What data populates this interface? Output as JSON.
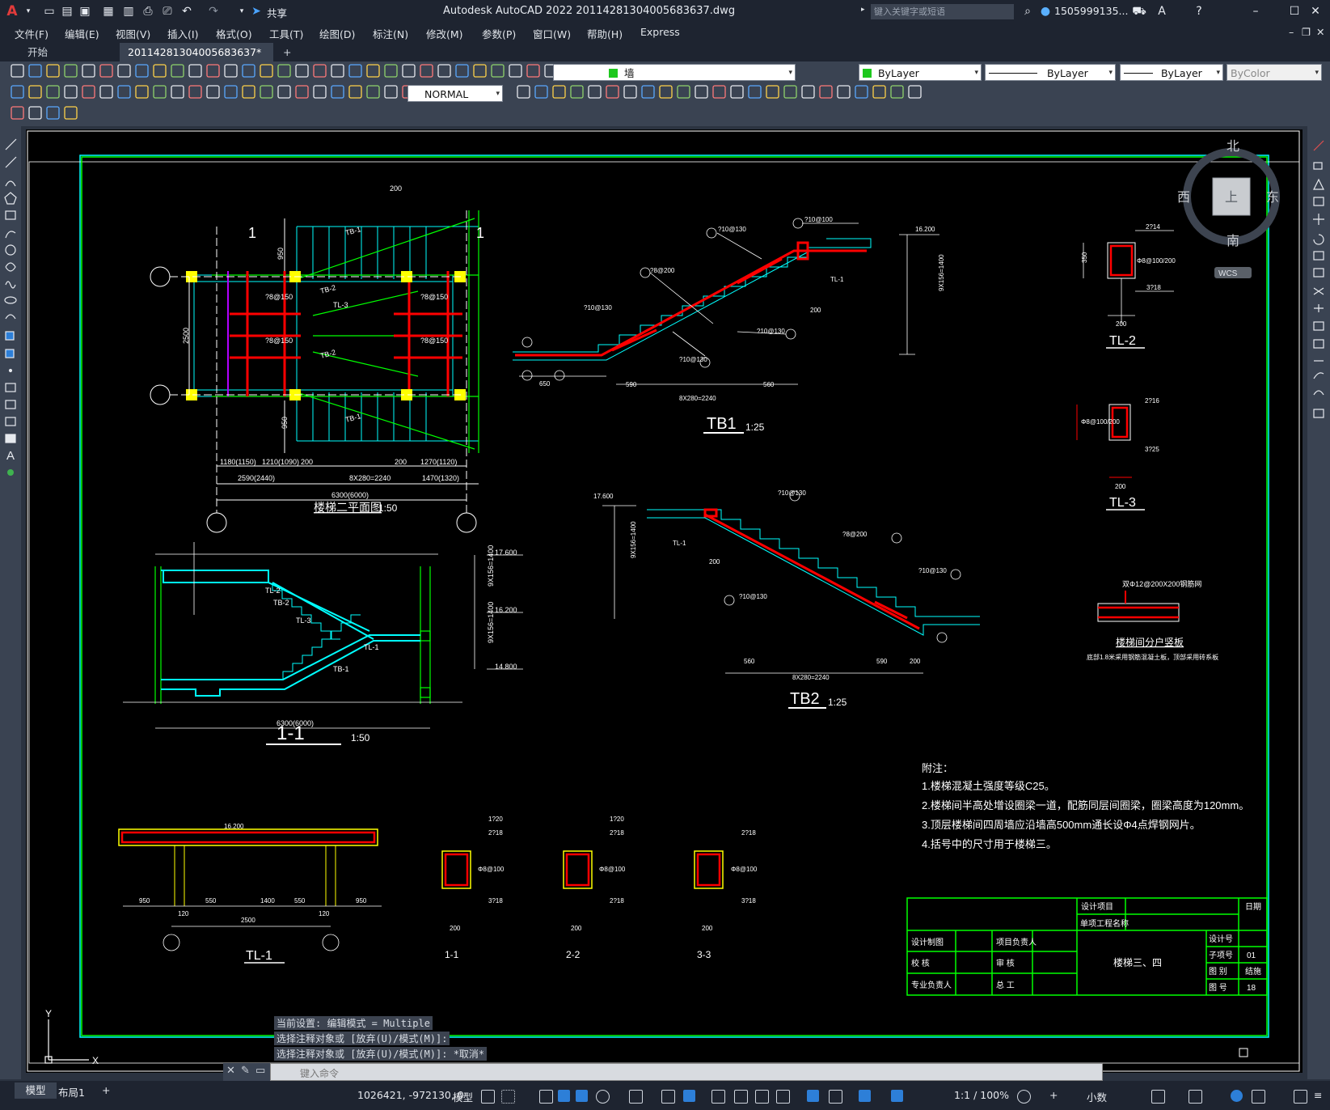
{
  "app": {
    "title": "Autodesk AutoCAD 2022    20114281304005683637.dwg",
    "search_placeholder": "键入关键字或短语",
    "user": "1505999135...",
    "share_label": "共享"
  },
  "menu": [
    "文件(F)",
    "编辑(E)",
    "视图(V)",
    "插入(I)",
    "格式(O)",
    "工具(T)",
    "绘图(D)",
    "标注(N)",
    "修改(M)",
    "参数(P)",
    "窗口(W)",
    "帮助(H)",
    "Express"
  ],
  "tabs": {
    "start": "开始",
    "active": "20114281304005683637*",
    "add": "+"
  },
  "properties": {
    "layer": "墙",
    "color": "ByLayer",
    "linetype": "ByLayer",
    "lineweight": "ByLayer",
    "plotstyle": "ByColor",
    "textstyle": "NORMAL"
  },
  "viewcube": {
    "north": "北",
    "south": "南",
    "east": "东",
    "west": "西",
    "top": "上",
    "wcs": "WCS"
  },
  "drawing": {
    "plan_title": "楼梯二平面图",
    "plan_scale": "1:50",
    "section_title": "1-1",
    "section_scale": "1:50",
    "tb1_title": "TB1",
    "tb1_scale": "1:25",
    "tb2_title": "TB2",
    "tb2_scale": "1:25",
    "tl1_title": "TL-1",
    "tl2_title": "TL-2",
    "tl3_title": "TL-3",
    "sec11": "1-1",
    "sec22": "2-2",
    "sec33": "3-3",
    "partition_title": "楼梯间分户竖板",
    "partition_note": "底部1.8米采用钢筋混凝土板，顶部采用砖系板",
    "partition_rebar": "双Φ12@200X200钢筋网",
    "notes_head": "附注：",
    "notes": [
      "1.楼梯混凝土强度等级C25。",
      "2.楼梯间半高处增设圈梁一道，配筋同层间圈梁，圈梁高度为120mm。",
      "3.顶层楼梯间四周墙应沿墙高500mm通长设Φ4点焊钢网片。",
      "4.括号中的尺寸用于楼梯三。"
    ],
    "dims": {
      "d200": "200",
      "d950": "950",
      "d2500": "2500",
      "d1180": "1180(1150)",
      "d1210": "1210(1090)",
      "d2590": "2590(2440)",
      "d8x280": "8X280=2240",
      "d1270": "1270(1120)",
      "d1470": "1470(1320)",
      "d6300": "6300(6000)",
      "d650": "650",
      "d590": "590",
      "d560": "560",
      "d16200": "16.200",
      "d17600": "17.600",
      "d14800": "14.800",
      "d9x156": "9X156=1400",
      "d1400": "1400",
      "d550": "550",
      "d120": "120",
      "d350": "350"
    },
    "labels": {
      "tb1": "TB-1",
      "tb2": "TB-2",
      "tl1": "TL-1",
      "tl2": "TL-2",
      "tl3": "TL-3",
      "r10": "?10@130",
      "r8": "?8@200",
      "r10b": "?10@100",
      "r8b": "?8@150",
      "r2y14": "2?14",
      "r3y18": "3?18",
      "r2y16": "2?16",
      "r3y25": "3?25",
      "r2y18": "2?18",
      "r1y20": "1?20",
      "stir": "Φ8@100/200",
      "stir2": "Φ8@100"
    },
    "titleblock": {
      "proj": "设计项目",
      "single": "单项工程名称",
      "date": "日期",
      "draw": "设计制图",
      "check": "校 核",
      "pro": "专业负责人",
      "lead": "项目负责人",
      "review": "审 核",
      "chief": "总 工",
      "name": "楼梯三、四",
      "dno": "设计号",
      "sno": "子项号",
      "sno_v": "01",
      "type": "图 别",
      "type_v": "结施",
      "no": "图 号",
      "no_v": "18"
    }
  },
  "command": {
    "line1": "当前设置: 编辑模式 = Multiple",
    "line2": "选择注释对象或 [放弃(U)/模式(M)]:",
    "line3": "选择注释对象或 [放弃(U)/模式(M)]: *取消*",
    "placeholder": "键入命令"
  },
  "status": {
    "model_tab": "模型",
    "layout_tab": "布局1",
    "coords": "1026421, -972130, 0",
    "model": "模型",
    "scale": "1:1 / 100%",
    "units": "小数"
  },
  "colors": {
    "cyan": "#00ffff",
    "green": "#00ff00",
    "red": "#ff0000",
    "yellow": "#ffff00",
    "white": "#ffffff"
  }
}
